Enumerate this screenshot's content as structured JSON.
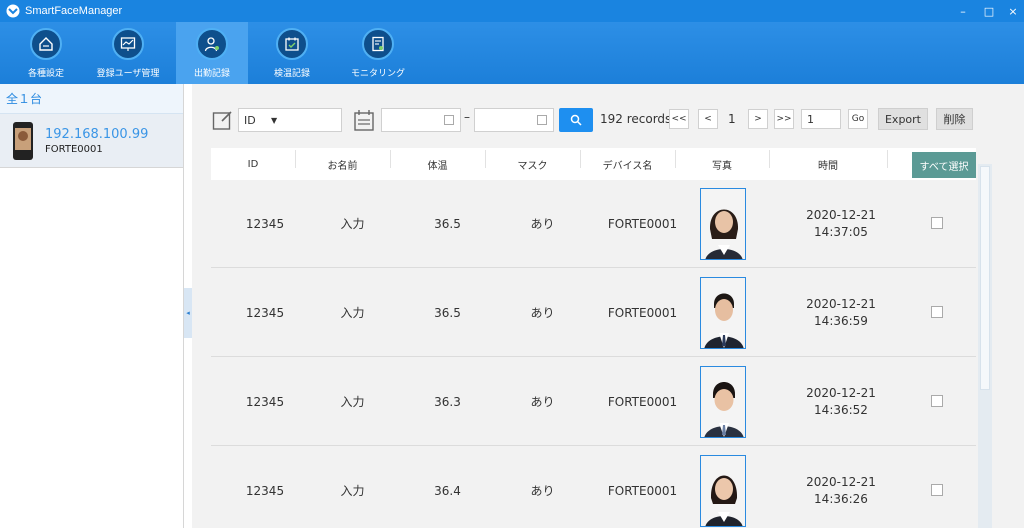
{
  "window": {
    "title": "SmartFaceManager",
    "controls": [
      "–",
      "□",
      "×"
    ]
  },
  "nav": {
    "items": [
      {
        "label": "各種設定",
        "icon": "home-icon",
        "active": false
      },
      {
        "label": "登録ユーザ管理",
        "icon": "board-chart-icon",
        "active": false
      },
      {
        "label": "出勤記録",
        "icon": "user-settings-icon",
        "active": true
      },
      {
        "label": "検温記録",
        "icon": "calendar-check-icon",
        "active": false
      },
      {
        "label": "モニタリング",
        "icon": "report-icon",
        "active": false
      }
    ]
  },
  "sidebar": {
    "header": "全１台",
    "device": {
      "ip": "192.168.100.99",
      "name": "FORTE0001"
    },
    "collapse_arrow": "◂"
  },
  "filter": {
    "field_select": "ID",
    "dash": "–",
    "records": "192 records",
    "pager": {
      "first": "<<",
      "prev": "<",
      "page": "1",
      "next": ">",
      "last": ">>",
      "goto_value": "1",
      "go": "Go"
    },
    "export": "Export",
    "delete": "削除"
  },
  "table": {
    "headers": [
      "ID",
      "お名前",
      "体温",
      "マスク",
      "デバイス名",
      "写真",
      "時間"
    ],
    "select_all": "すべて選択",
    "rows": [
      {
        "id": "12345",
        "name": "入力",
        "temp": "36.5",
        "mask": "あり",
        "device": "FORTE0001",
        "date": "2020-12-21",
        "time": "14:37:05",
        "photo": "woman-portrait"
      },
      {
        "id": "12345",
        "name": "入力",
        "temp": "36.5",
        "mask": "あり",
        "device": "FORTE0001",
        "date": "2020-12-21",
        "time": "14:36:59",
        "photo": "man-portrait"
      },
      {
        "id": "12345",
        "name": "入力",
        "temp": "36.3",
        "mask": "あり",
        "device": "FORTE0001",
        "date": "2020-12-21",
        "time": "14:36:52",
        "photo": "man-portrait"
      },
      {
        "id": "12345",
        "name": "入力",
        "temp": "36.4",
        "mask": "あり",
        "device": "FORTE0001",
        "date": "2020-12-21",
        "time": "14:36:26",
        "photo": "woman-portrait"
      }
    ]
  },
  "colors": {
    "titlebar": "#1a84e0",
    "accent": "#1e8ff0",
    "select_all": "#5b9a95"
  }
}
